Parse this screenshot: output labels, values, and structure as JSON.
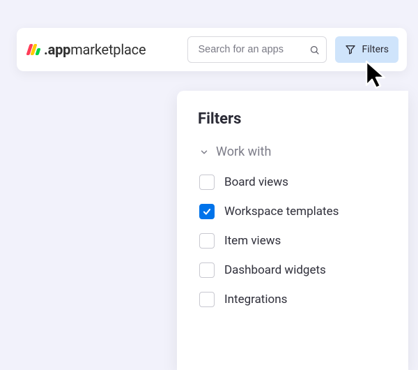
{
  "logo": {
    "bold": ".app",
    "light": "marketplace"
  },
  "search": {
    "placeholder": "Search for an apps"
  },
  "filters_button": {
    "label": "Filters"
  },
  "panel": {
    "title": "Filters",
    "section": "Work with",
    "options": [
      {
        "label": "Board views",
        "checked": false
      },
      {
        "label": "Workspace templates",
        "checked": true
      },
      {
        "label": "Item views",
        "checked": false
      },
      {
        "label": "Dashboard widgets",
        "checked": false
      },
      {
        "label": "Integrations",
        "checked": false
      }
    ]
  }
}
